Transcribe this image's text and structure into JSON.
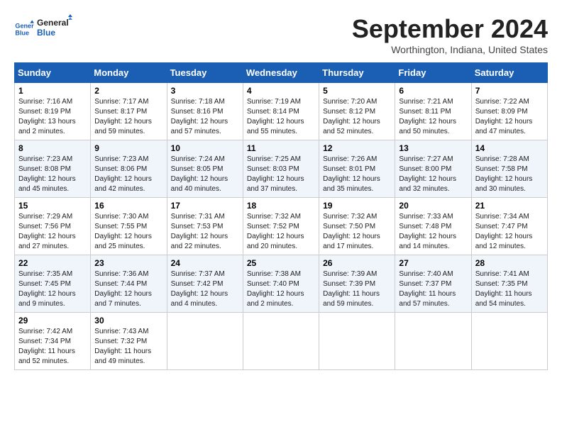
{
  "header": {
    "logo_line1": "General",
    "logo_line2": "Blue",
    "title": "September 2024",
    "subtitle": "Worthington, Indiana, United States"
  },
  "weekdays": [
    "Sunday",
    "Monday",
    "Tuesday",
    "Wednesday",
    "Thursday",
    "Friday",
    "Saturday"
  ],
  "weeks": [
    [
      {
        "day": "1",
        "sunrise": "Sunrise: 7:16 AM",
        "sunset": "Sunset: 8:19 PM",
        "daylight": "Daylight: 13 hours and 2 minutes."
      },
      {
        "day": "2",
        "sunrise": "Sunrise: 7:17 AM",
        "sunset": "Sunset: 8:17 PM",
        "daylight": "Daylight: 12 hours and 59 minutes."
      },
      {
        "day": "3",
        "sunrise": "Sunrise: 7:18 AM",
        "sunset": "Sunset: 8:16 PM",
        "daylight": "Daylight: 12 hours and 57 minutes."
      },
      {
        "day": "4",
        "sunrise": "Sunrise: 7:19 AM",
        "sunset": "Sunset: 8:14 PM",
        "daylight": "Daylight: 12 hours and 55 minutes."
      },
      {
        "day": "5",
        "sunrise": "Sunrise: 7:20 AM",
        "sunset": "Sunset: 8:12 PM",
        "daylight": "Daylight: 12 hours and 52 minutes."
      },
      {
        "day": "6",
        "sunrise": "Sunrise: 7:21 AM",
        "sunset": "Sunset: 8:11 PM",
        "daylight": "Daylight: 12 hours and 50 minutes."
      },
      {
        "day": "7",
        "sunrise": "Sunrise: 7:22 AM",
        "sunset": "Sunset: 8:09 PM",
        "daylight": "Daylight: 12 hours and 47 minutes."
      }
    ],
    [
      {
        "day": "8",
        "sunrise": "Sunrise: 7:23 AM",
        "sunset": "Sunset: 8:08 PM",
        "daylight": "Daylight: 12 hours and 45 minutes."
      },
      {
        "day": "9",
        "sunrise": "Sunrise: 7:23 AM",
        "sunset": "Sunset: 8:06 PM",
        "daylight": "Daylight: 12 hours and 42 minutes."
      },
      {
        "day": "10",
        "sunrise": "Sunrise: 7:24 AM",
        "sunset": "Sunset: 8:05 PM",
        "daylight": "Daylight: 12 hours and 40 minutes."
      },
      {
        "day": "11",
        "sunrise": "Sunrise: 7:25 AM",
        "sunset": "Sunset: 8:03 PM",
        "daylight": "Daylight: 12 hours and 37 minutes."
      },
      {
        "day": "12",
        "sunrise": "Sunrise: 7:26 AM",
        "sunset": "Sunset: 8:01 PM",
        "daylight": "Daylight: 12 hours and 35 minutes."
      },
      {
        "day": "13",
        "sunrise": "Sunrise: 7:27 AM",
        "sunset": "Sunset: 8:00 PM",
        "daylight": "Daylight: 12 hours and 32 minutes."
      },
      {
        "day": "14",
        "sunrise": "Sunrise: 7:28 AM",
        "sunset": "Sunset: 7:58 PM",
        "daylight": "Daylight: 12 hours and 30 minutes."
      }
    ],
    [
      {
        "day": "15",
        "sunrise": "Sunrise: 7:29 AM",
        "sunset": "Sunset: 7:56 PM",
        "daylight": "Daylight: 12 hours and 27 minutes."
      },
      {
        "day": "16",
        "sunrise": "Sunrise: 7:30 AM",
        "sunset": "Sunset: 7:55 PM",
        "daylight": "Daylight: 12 hours and 25 minutes."
      },
      {
        "day": "17",
        "sunrise": "Sunrise: 7:31 AM",
        "sunset": "Sunset: 7:53 PM",
        "daylight": "Daylight: 12 hours and 22 minutes."
      },
      {
        "day": "18",
        "sunrise": "Sunrise: 7:32 AM",
        "sunset": "Sunset: 7:52 PM",
        "daylight": "Daylight: 12 hours and 20 minutes."
      },
      {
        "day": "19",
        "sunrise": "Sunrise: 7:32 AM",
        "sunset": "Sunset: 7:50 PM",
        "daylight": "Daylight: 12 hours and 17 minutes."
      },
      {
        "day": "20",
        "sunrise": "Sunrise: 7:33 AM",
        "sunset": "Sunset: 7:48 PM",
        "daylight": "Daylight: 12 hours and 14 minutes."
      },
      {
        "day": "21",
        "sunrise": "Sunrise: 7:34 AM",
        "sunset": "Sunset: 7:47 PM",
        "daylight": "Daylight: 12 hours and 12 minutes."
      }
    ],
    [
      {
        "day": "22",
        "sunrise": "Sunrise: 7:35 AM",
        "sunset": "Sunset: 7:45 PM",
        "daylight": "Daylight: 12 hours and 9 minutes."
      },
      {
        "day": "23",
        "sunrise": "Sunrise: 7:36 AM",
        "sunset": "Sunset: 7:44 PM",
        "daylight": "Daylight: 12 hours and 7 minutes."
      },
      {
        "day": "24",
        "sunrise": "Sunrise: 7:37 AM",
        "sunset": "Sunset: 7:42 PM",
        "daylight": "Daylight: 12 hours and 4 minutes."
      },
      {
        "day": "25",
        "sunrise": "Sunrise: 7:38 AM",
        "sunset": "Sunset: 7:40 PM",
        "daylight": "Daylight: 12 hours and 2 minutes."
      },
      {
        "day": "26",
        "sunrise": "Sunrise: 7:39 AM",
        "sunset": "Sunset: 7:39 PM",
        "daylight": "Daylight: 11 hours and 59 minutes."
      },
      {
        "day": "27",
        "sunrise": "Sunrise: 7:40 AM",
        "sunset": "Sunset: 7:37 PM",
        "daylight": "Daylight: 11 hours and 57 minutes."
      },
      {
        "day": "28",
        "sunrise": "Sunrise: 7:41 AM",
        "sunset": "Sunset: 7:35 PM",
        "daylight": "Daylight: 11 hours and 54 minutes."
      }
    ],
    [
      {
        "day": "29",
        "sunrise": "Sunrise: 7:42 AM",
        "sunset": "Sunset: 7:34 PM",
        "daylight": "Daylight: 11 hours and 52 minutes."
      },
      {
        "day": "30",
        "sunrise": "Sunrise: 7:43 AM",
        "sunset": "Sunset: 7:32 PM",
        "daylight": "Daylight: 11 hours and 49 minutes."
      },
      null,
      null,
      null,
      null,
      null
    ]
  ]
}
